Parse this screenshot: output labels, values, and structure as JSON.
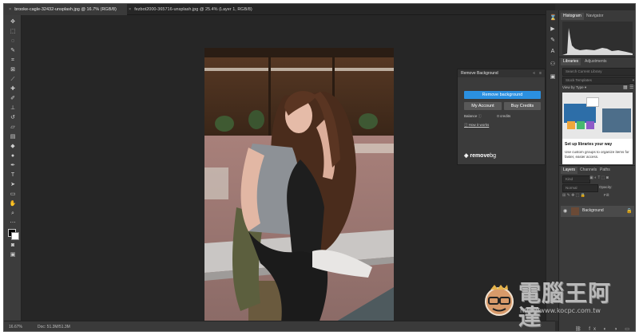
{
  "tabs": [
    {
      "label": "brooke-cagle-32432-unsplash.jpg @ 16.7% (RGB/8)",
      "active": true
    },
    {
      "label": "fezbot2000-365716-unsplash.jpg @ 25.4% (Layer 1, RGB/8)",
      "active": false
    }
  ],
  "status": {
    "zoom": "16.67%",
    "doc": "Doc: 51.3M/51.3M"
  },
  "remove_bg": {
    "title": "Remove Background",
    "primary_button": "Remove background",
    "account_button": "My Account",
    "credits_button": "Buy Credits",
    "balance_label": "Balance",
    "balance_value": "0 credits",
    "how_link": "How it works",
    "brand": "remove",
    "brand_suffix": "bg",
    "colors": {
      "primary": "#2b90e0",
      "secondary": "#595959"
    }
  },
  "histogram": {
    "tab1": "Histogram",
    "tab2": "Navigator"
  },
  "libraries": {
    "tab1": "Libraries",
    "tab2": "Adjustments",
    "search_placeholder": "Search Current Library",
    "stock_label": "Stock Templates",
    "view_label": "View by Type",
    "setup_title": "Set up libraries your way",
    "setup_body": "Use custom groups to organize items for faster, easier access."
  },
  "layers": {
    "tab1": "Layers",
    "tab2": "Channels",
    "tab3": "Paths",
    "kind_label": "Kind",
    "blend_label": "Normal",
    "opacity_label": "Opacity:",
    "fill_label": "Fill:",
    "layer_name": "Background"
  },
  "watermark": {
    "text": "電腦王阿達",
    "url": "http://www.kocpc.com.tw"
  }
}
